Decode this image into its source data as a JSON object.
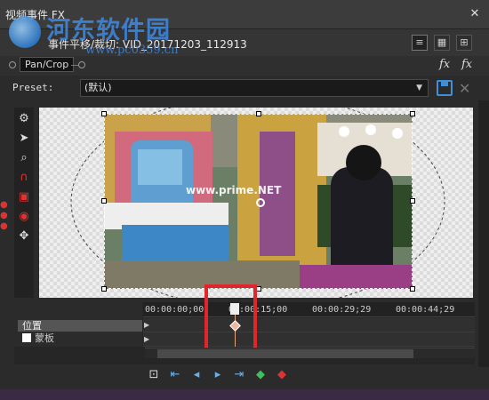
{
  "window": {
    "title": "视频事件 FX",
    "close": "✕"
  },
  "watermark": {
    "text": "河东软件园",
    "url": "www.pc0359.cn",
    "photo_overlay": "www.prime.NET"
  },
  "header": {
    "fx_title": "事件平移/裁切: VID_20171203_112913"
  },
  "plugin": {
    "chip_label": "Pan/Crop"
  },
  "preset": {
    "label": "Preset:",
    "value": "(默认)"
  },
  "tools": [
    {
      "name": "gear-icon",
      "glyph": "⚙"
    },
    {
      "name": "pointer-icon",
      "glyph": "➤"
    },
    {
      "name": "zoom-icon",
      "glyph": "🔍"
    },
    {
      "name": "magnet-icon",
      "glyph": "∩"
    },
    {
      "name": "lock-aspect-icon",
      "glyph": "▣"
    },
    {
      "name": "lock-center-icon",
      "glyph": "◉"
    },
    {
      "name": "move-icon",
      "glyph": "✥"
    }
  ],
  "tracks": [
    {
      "label": "位置"
    },
    {
      "label": "蒙板"
    }
  ],
  "timecodes": [
    "00:00:00;00",
    "00:00:15;00",
    "00:00:29;29",
    "00:00:44;29"
  ],
  "colors": {
    "accent": "#3e8fd8",
    "highlight": "#e0252d",
    "keyframe": "#e9b9a0"
  }
}
